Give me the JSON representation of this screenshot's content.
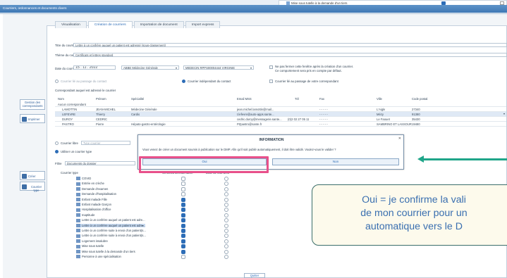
{
  "window": {
    "title": "Courriers, ordonnances et documents divers",
    "notification": "Mise sous tutelle à la demande d'un tiers"
  },
  "tabs": [
    {
      "label": "Visualisation"
    },
    {
      "label": "Création de courriers"
    },
    {
      "label": "Importation de document"
    },
    {
      "label": "Import express"
    }
  ],
  "form": {
    "titre_label": "Titre du courrier",
    "titre_value": "Lettre à un confrère auquel un patient est adressé (sous-classement)",
    "theme_label": "Thème du courrier",
    "theme_value": "Certificats et lettres standard",
    "date_label": "Date du courrier",
    "date_value": "15 . 11 . 2022",
    "author_value": "ABBE Médecine Générale",
    "doctor_value": "MEDECIN RPPS00004444 VIRGINIE",
    "option1": "Ne pas fermer cette fenêtre après la création d'un courrier.",
    "option1b": "Ce comportement sera pris en compte par défaut.",
    "option2": "Courrier lié au passage du contact",
    "option3": "Courrier indépendant du contact",
    "option4": "Courrier lié au passage de votre correspondant",
    "correspondant_label": "Correspondant auquel est adressé le courrier"
  },
  "table": {
    "headers": [
      "Nom",
      "Prénom",
      "Spécialité",
      "Email MSS",
      "Tél",
      "Fax",
      "Ville",
      "Code postal"
    ],
    "rows": [
      {
        "nom": "Aucun correspondant",
        "prenom": "",
        "spec": "",
        "email": "",
        "tel": "",
        "fax": "",
        "ville": "",
        "cp": ""
      },
      {
        "nom": "LAMOTTIN",
        "prenom": "JEAN-MICHEL",
        "spec": "Médecine Générale",
        "email": "jean.michel.lamottin@mail...",
        "tel": "",
        "fax": "- - - - -",
        "ville": "L'Aigle",
        "cp": "27340"
      },
      {
        "nom": "LEFEVRE",
        "prenom": "Thierry",
        "spec": "Cardio",
        "email": "t.lefevre@auto-apps.sante...",
        "tel": "",
        "fax": "- - - - -",
        "ville": "Mézy",
        "cp": "91380"
      },
      {
        "nom": "DUROY",
        "prenom": "CEDRIC",
        "spec": "",
        "email": "cedric.duroy@messagerie.sante...",
        "tel": "(0)2 02 27 05 11",
        "fax": "- - - - -",
        "ville": "Le Faouet",
        "cp": "35430"
      },
      {
        "nom": "PASTRO",
        "prenom": "Pierre",
        "spec": "Hépato-gastro-entérologie",
        "email": "PZpastro@sante.fr",
        "tel": "",
        "fax": "- - - - -",
        "ville": "SAMBRINO ET LASSOUR",
        "cp": "19480"
      }
    ]
  },
  "left_buttons": {
    "correspondant": "Gestion des correspondants",
    "imprimer": "Imprimer",
    "creer": "Créer",
    "courrier_type": "Courrier type"
  },
  "libre": {
    "courrier_libre": "Courrier libre",
    "type_placeholder": "Type courrier",
    "utiliser": "Utiliser un courrier type",
    "filtre_label": "Filtre",
    "filtre_value": "Documents du dossier"
  },
  "dialog": {
    "title": "INFORMATION",
    "message": "Vous venez de créer un document soumis à publication sur le DMP. Afin qu'il soit publié automatiquement, il doit être validé. Voulez-vous le valider ?",
    "yes": "Oui",
    "no": "Non"
  },
  "tree": {
    "header_type": "Courrier type",
    "header_cert": "Certificat dématérialisé",
    "header_auto": "Date de tout droit",
    "items": [
      {
        "label": "COVID",
        "checked": false,
        "selected": false
      },
      {
        "label": "Entrée en crèche",
        "checked": false,
        "selected": false
      },
      {
        "label": "Demande d'examen",
        "checked": false,
        "selected": false
      },
      {
        "label": "Demande d'hospitalisation",
        "checked": false,
        "selected": false
      },
      {
        "label": "Enfant malade Fille",
        "checked": true,
        "selected": false
      },
      {
        "label": "Enfant malade Garçon",
        "checked": true,
        "selected": false
      },
      {
        "label": "Hospitalisation d'office",
        "checked": true,
        "selected": false
      },
      {
        "label": "Inaptitude",
        "checked": true,
        "selected": false
      },
      {
        "label": "Lettre à un confrère auquel un patient est adre...",
        "checked": true,
        "selected": false
      },
      {
        "label": "Lettre à un confrère auquel un patient est adre...",
        "checked": true,
        "selected": true
      },
      {
        "label": "Lettre à un confrère suite à envoi d'un patient(s...",
        "checked": true,
        "selected": false
      },
      {
        "label": "Lettre à un confrère suite à envoi d'un patient(s...",
        "checked": true,
        "selected": false
      },
      {
        "label": "Logement insalubre",
        "checked": true,
        "selected": false
      },
      {
        "label": "Mise sous tutelle",
        "checked": true,
        "selected": false
      },
      {
        "label": "Mise sous tutelle à la demande d'un tiers",
        "checked": true,
        "selected": false
      },
      {
        "label": "Personne à une spécialisation",
        "checked": false,
        "selected": false
      }
    ]
  },
  "callout": {
    "line1": "Oui = je confirme la vali",
    "line2": "de mon courrier pour un",
    "line3": "automatique vers le D"
  },
  "bottom": {
    "close_label": "Quitter"
  },
  "colors": {
    "accent": "#2d6db7",
    "highlight": "#e8508a",
    "arrow": "#1fa589",
    "callout_text": "#3a6fb0"
  }
}
